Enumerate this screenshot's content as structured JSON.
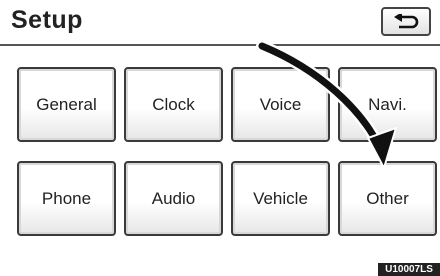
{
  "header": {
    "title": "Setup"
  },
  "buttons": [
    "General",
    "Clock",
    "Voice",
    "Navi.",
    "Phone",
    "Audio",
    "Vehicle",
    "Other"
  ],
  "figure_code": "U10007LS"
}
